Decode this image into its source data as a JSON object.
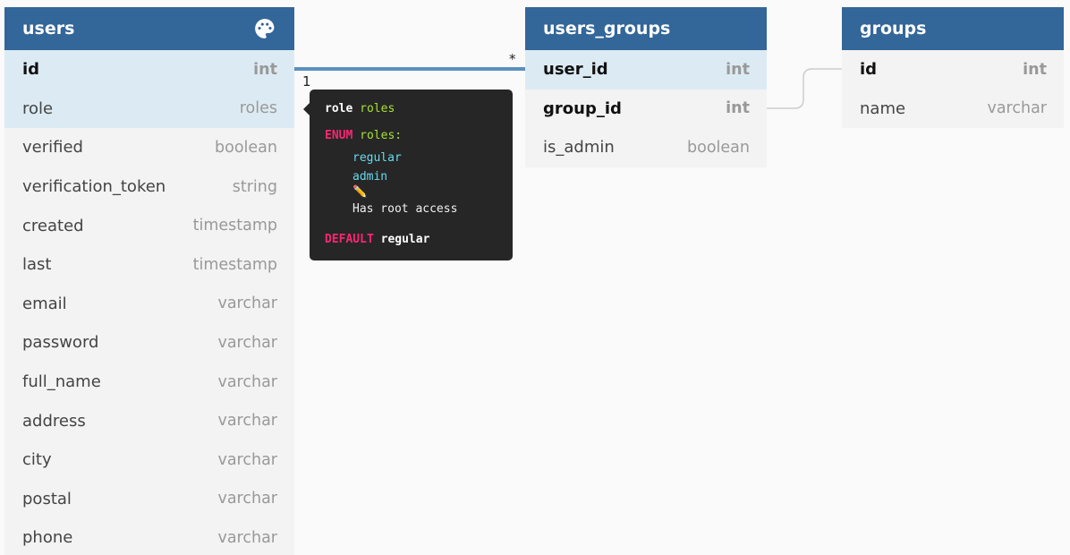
{
  "tables": {
    "users": {
      "title": "users",
      "columns": [
        {
          "name": "id",
          "type": "int"
        },
        {
          "name": "role",
          "type": "roles"
        },
        {
          "name": "verified",
          "type": "boolean"
        },
        {
          "name": "verification_token",
          "type": "string"
        },
        {
          "name": "created",
          "type": "timestamp"
        },
        {
          "name": "last",
          "type": "timestamp"
        },
        {
          "name": "email",
          "type": "varchar"
        },
        {
          "name": "password",
          "type": "varchar"
        },
        {
          "name": "full_name",
          "type": "varchar"
        },
        {
          "name": "address",
          "type": "varchar"
        },
        {
          "name": "city",
          "type": "varchar"
        },
        {
          "name": "postal",
          "type": "varchar"
        },
        {
          "name": "phone",
          "type": "varchar"
        }
      ]
    },
    "users_groups": {
      "title": "users_groups",
      "columns": [
        {
          "name": "user_id",
          "type": "int"
        },
        {
          "name": "group_id",
          "type": "int"
        },
        {
          "name": "is_admin",
          "type": "boolean"
        }
      ]
    },
    "groups": {
      "title": "groups",
      "columns": [
        {
          "name": "id",
          "type": "int"
        },
        {
          "name": "name",
          "type": "varchar"
        }
      ]
    }
  },
  "relations": {
    "users_to_users_groups": {
      "from_cardinality": "1",
      "to_cardinality": "*"
    }
  },
  "tooltip": {
    "column": "role",
    "type": "roles",
    "enum_keyword": "ENUM",
    "enum_name": "roles:",
    "values": [
      "regular",
      "admin"
    ],
    "note_icon": "✏️",
    "note": "Has root access",
    "default_keyword": "DEFAULT",
    "default_value": "regular"
  },
  "colors": {
    "header": "#336699",
    "highlight": "#dcebf3",
    "relation_line": "#5b8fbf"
  },
  "icons": {
    "header_icon": "palette-icon"
  }
}
